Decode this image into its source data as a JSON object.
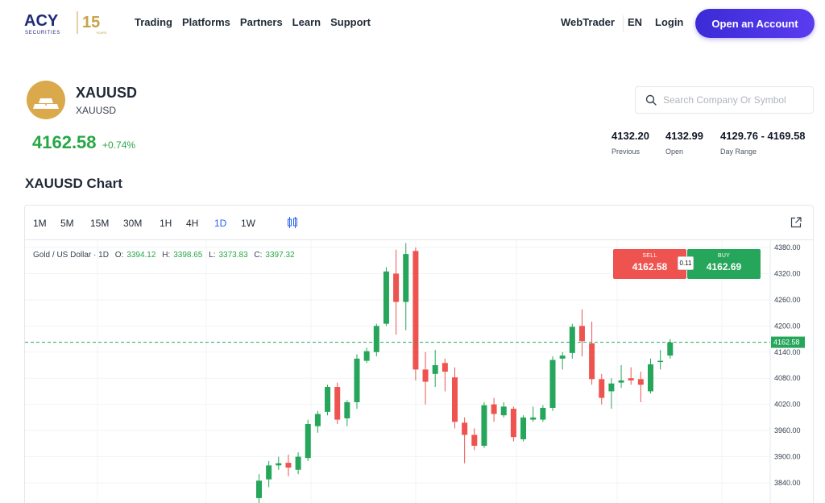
{
  "header": {
    "logo_text": "ACY",
    "logo_sub": "SECURITIES",
    "anniv_number": "15",
    "anniv_label": "YEARS",
    "nav": [
      "Trading",
      "Platforms",
      "Partners",
      "Learn",
      "Support"
    ],
    "webtrader": "WebTrader",
    "lang": "EN",
    "login": "Login",
    "cta": "Open an Account",
    "brand_color": "#4a32e0"
  },
  "symbol": {
    "name": "XAUUSD",
    "sub": "XAUUSD",
    "price": "4162.58",
    "change": "+0.74%",
    "icon": "gold-bars-icon"
  },
  "search": {
    "placeholder": "Search Company Or Symbol"
  },
  "stats": [
    {
      "value": "4132.20",
      "label": "Previous"
    },
    {
      "value": "4132.99",
      "label": "Open"
    },
    {
      "value": "4129.76 - 4169.58",
      "label": "Day Range"
    }
  ],
  "chart_section_title": "XAUUSD Chart",
  "toolbar": {
    "timeframes": [
      "1M",
      "5M",
      "15M",
      "30M",
      "1H",
      "4H",
      "1D",
      "1W"
    ],
    "active": "1D"
  },
  "legend": {
    "name": "Gold / US Dollar · 1D",
    "o_label": "O:",
    "o": "3394.12",
    "h_label": "H:",
    "h": "3398.65",
    "l_label": "L:",
    "l": "3373.83",
    "c_label": "C:",
    "c": "3397.32"
  },
  "trade": {
    "sell_label": "SELL",
    "sell_price": "4162.58",
    "buy_label": "BUY",
    "buy_price": "4162.69",
    "spread": "0.11"
  },
  "colors": {
    "up": "#26a65b",
    "down": "#ef5350",
    "price_line": "#26a65b"
  },
  "chart_data": {
    "type": "candlestick",
    "y_ticks": [
      "4380.00",
      "4320.00",
      "4260.00",
      "4200.00",
      "4140.00",
      "4080.00",
      "4020.00",
      "3960.00",
      "3900.00",
      "3840.00"
    ],
    "last_price_label": "4162.58",
    "ylim": [
      3820,
      4390
    ],
    "candles": [
      {
        "o": 3805,
        "h": 3860,
        "l": 3790,
        "c": 3845
      },
      {
        "o": 3848,
        "h": 3890,
        "l": 3830,
        "c": 3880
      },
      {
        "o": 3880,
        "h": 3900,
        "l": 3870,
        "c": 3885
      },
      {
        "o": 3886,
        "h": 3905,
        "l": 3855,
        "c": 3875
      },
      {
        "o": 3870,
        "h": 3910,
        "l": 3860,
        "c": 3900
      },
      {
        "o": 3897,
        "h": 3985,
        "l": 3890,
        "c": 3975
      },
      {
        "o": 3970,
        "h": 4005,
        "l": 3955,
        "c": 3998
      },
      {
        "o": 4003,
        "h": 4065,
        "l": 3995,
        "c": 4060
      },
      {
        "o": 4060,
        "h": 4070,
        "l": 3975,
        "c": 3985
      },
      {
        "o": 3988,
        "h": 4030,
        "l": 3970,
        "c": 4025
      },
      {
        "o": 4025,
        "h": 4135,
        "l": 4010,
        "c": 4125
      },
      {
        "o": 4120,
        "h": 4150,
        "l": 4115,
        "c": 4142
      },
      {
        "o": 4140,
        "h": 4205,
        "l": 4130,
        "c": 4200
      },
      {
        "o": 4205,
        "h": 4335,
        "l": 4200,
        "c": 4325
      },
      {
        "o": 4320,
        "h": 4375,
        "l": 4180,
        "c": 4255
      },
      {
        "o": 4255,
        "h": 4390,
        "l": 4190,
        "c": 4365
      },
      {
        "o": 4372,
        "h": 4380,
        "l": 4075,
        "c": 4100
      },
      {
        "o": 4100,
        "h": 4140,
        "l": 4020,
        "c": 4072
      },
      {
        "o": 4090,
        "h": 4145,
        "l": 4060,
        "c": 4110
      },
      {
        "o": 4115,
        "h": 4125,
        "l": 4050,
        "c": 4095
      },
      {
        "o": 4082,
        "h": 4105,
        "l": 3965,
        "c": 3980
      },
      {
        "o": 3978,
        "h": 3990,
        "l": 3885,
        "c": 3950
      },
      {
        "o": 3950,
        "h": 3965,
        "l": 3915,
        "c": 3925
      },
      {
        "o": 3925,
        "h": 4025,
        "l": 3920,
        "c": 4018
      },
      {
        "o": 4020,
        "h": 4035,
        "l": 3980,
        "c": 3998
      },
      {
        "o": 3995,
        "h": 4025,
        "l": 3990,
        "c": 4015
      },
      {
        "o": 4010,
        "h": 4015,
        "l": 3935,
        "c": 3945
      },
      {
        "o": 3940,
        "h": 3995,
        "l": 3935,
        "c": 3990
      },
      {
        "o": 3985,
        "h": 4015,
        "l": 3980,
        "c": 3990
      },
      {
        "o": 3985,
        "h": 4018,
        "l": 3980,
        "c": 4012
      },
      {
        "o": 4012,
        "h": 4130,
        "l": 4005,
        "c": 4122
      },
      {
        "o": 4125,
        "h": 4140,
        "l": 4100,
        "c": 4132
      },
      {
        "o": 4138,
        "h": 4205,
        "l": 4125,
        "c": 4198
      },
      {
        "o": 4200,
        "h": 4238,
        "l": 4130,
        "c": 4165
      },
      {
        "o": 4160,
        "h": 4210,
        "l": 4065,
        "c": 4078
      },
      {
        "o": 4078,
        "h": 4090,
        "l": 4020,
        "c": 4035
      },
      {
        "o": 4050,
        "h": 4080,
        "l": 4010,
        "c": 4068
      },
      {
        "o": 4070,
        "h": 4110,
        "l": 4058,
        "c": 4075
      },
      {
        "o": 4080,
        "h": 4105,
        "l": 4065,
        "c": 4075
      },
      {
        "o": 4078,
        "h": 4095,
        "l": 4025,
        "c": 4065
      },
      {
        "o": 4050,
        "h": 4125,
        "l": 4045,
        "c": 4112
      },
      {
        "o": 4118,
        "h": 4145,
        "l": 4100,
        "c": 4120
      },
      {
        "o": 4132,
        "h": 4170,
        "l": 4125,
        "c": 4162
      }
    ]
  }
}
